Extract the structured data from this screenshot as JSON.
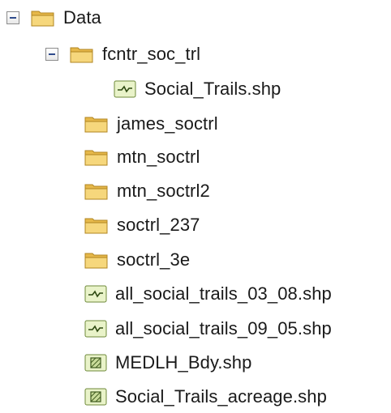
{
  "tree": {
    "root": {
      "label": "Data",
      "icon": "folder-icon",
      "expanded": true
    },
    "subfolder": {
      "label": "fcntr_soc_trl",
      "icon": "folder-icon",
      "expanded": true,
      "children": [
        {
          "label": "Social_Trails.shp",
          "icon": "line-shapefile-icon"
        }
      ]
    },
    "items": [
      {
        "label": "james_soctrl",
        "icon": "folder-icon"
      },
      {
        "label": "mtn_soctrl",
        "icon": "folder-icon"
      },
      {
        "label": "mtn_soctrl2",
        "icon": "folder-icon"
      },
      {
        "label": "soctrl_237",
        "icon": "folder-icon"
      },
      {
        "label": "soctrl_3e",
        "icon": "folder-icon"
      },
      {
        "label": "all_social_trails_03_08.shp",
        "icon": "line-shapefile-icon"
      },
      {
        "label": "all_social_trails_09_05.shp",
        "icon": "line-shapefile-icon"
      },
      {
        "label": "MEDLH_Bdy.shp",
        "icon": "polygon-shapefile-icon"
      },
      {
        "label": "Social_Trails_acreage.shp",
        "icon": "polygon-shapefile-icon"
      }
    ]
  }
}
